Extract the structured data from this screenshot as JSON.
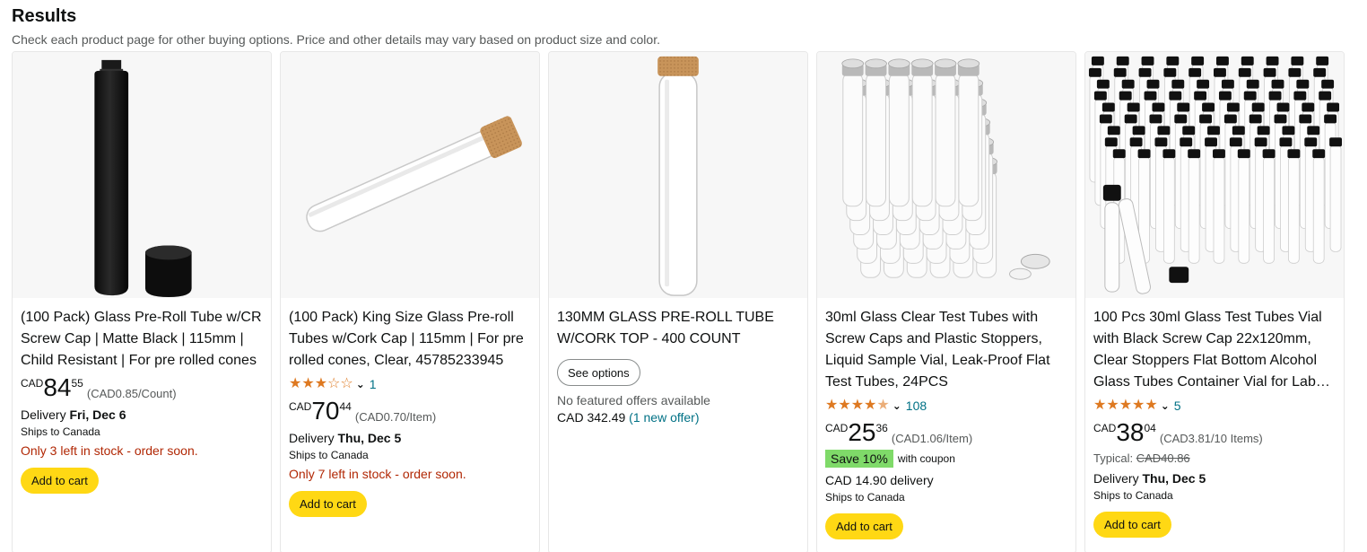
{
  "header": {
    "title": "Results",
    "subtitle": "Check each product page for other buying options. Price and other details may vary based on product size and color."
  },
  "colors": {
    "star": "#de7921",
    "link": "#007185",
    "stock": "#b12704",
    "cart_button": "#ffd814",
    "save_badge": "#7fda69"
  },
  "products": [
    {
      "title": "(100 Pack) Glass Pre-Roll Tube w/CR Screw Cap | Matte Black | 115mm | Child Resistant | For pre rolled cones",
      "price_symbol": "CAD",
      "price_whole": "84",
      "price_fraction": "55",
      "unit_price": "(CAD0.85/Count)",
      "delivery_label": "Delivery ",
      "delivery_date": "Fri, Dec 6",
      "ships": "Ships to Canada",
      "stock": "Only 3 left in stock - order soon.",
      "button": "Add to cart"
    },
    {
      "title": "(100 Pack) King Size Glass Pre-roll Tubes w/Cork Cap | 115mm | For pre rolled cones, Clear, 45785233945",
      "rating": 3,
      "rating_icon": "star-rating-icon",
      "review_count": "1",
      "price_symbol": "CAD",
      "price_whole": "70",
      "price_fraction": "44",
      "unit_price": "(CAD0.70/Item)",
      "delivery_label": "Delivery ",
      "delivery_date": "Thu, Dec 5",
      "ships": "Ships to Canada",
      "stock": "Only 7 left in stock - order soon.",
      "button": "Add to cart"
    },
    {
      "title": "130MM GLASS PRE-ROLL TUBE W/CORK TOP - 400 COUNT",
      "button": "See options",
      "no_offer": "No featured offers available",
      "offer_price": "CAD 342.49 ",
      "offer_link": "(1 new offer)"
    },
    {
      "title": "30ml Glass Clear Test Tubes with Screw Caps and Plastic Stoppers, Liquid Sample Vial, Leak-Proof Flat Test Tubes, 24PCS",
      "rating": 4.5,
      "review_count": "108",
      "price_symbol": "CAD",
      "price_whole": "25",
      "price_fraction": "36",
      "unit_price": "(CAD1.06/Item)",
      "save_badge": "Save 10%",
      "coupon": "with coupon",
      "delivery_fee": "CAD 14.90 delivery",
      "ships": "Ships to Canada",
      "button": "Add to cart"
    },
    {
      "title": "100 Pcs 30ml Glass Test Tubes Vial with Black Screw Cap 22x120mm, Clear Stoppers Flat Bottom Alcohol Glass Tubes Container Vial for Lab…",
      "rating": 5,
      "review_count": "5",
      "price_symbol": "CAD",
      "price_whole": "38",
      "price_fraction": "04",
      "unit_price": "(CAD3.81/10 Items)",
      "typical_label": "Typical: ",
      "typical_price": "CAD40.86",
      "delivery_label": "Delivery ",
      "delivery_date": "Thu, Dec 5",
      "ships": "Ships to Canada",
      "button": "Add to cart"
    }
  ]
}
